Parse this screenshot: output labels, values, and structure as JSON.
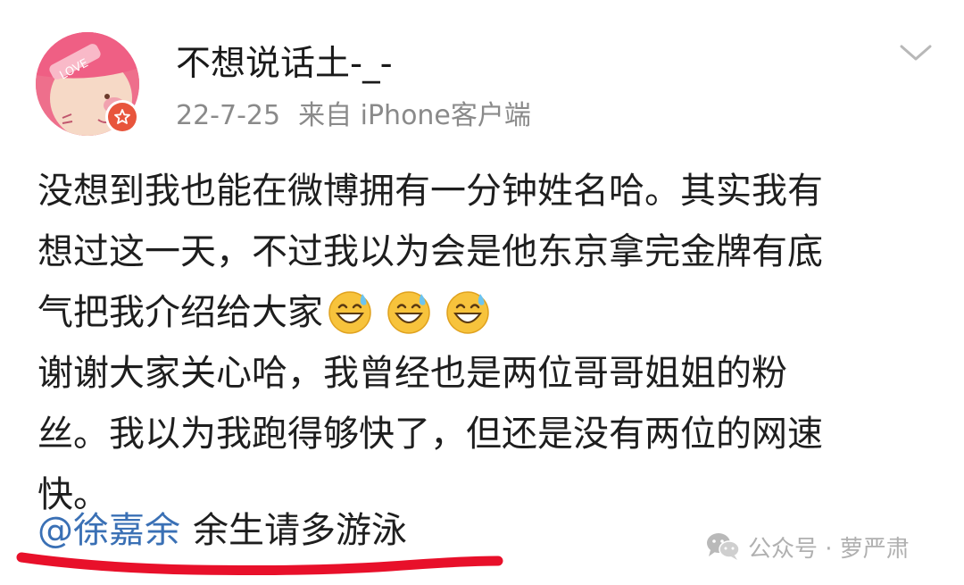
{
  "post": {
    "author": {
      "name": "不想说话土-_-",
      "avatar_text": "LOVE"
    },
    "date": "22-7-25",
    "source": "来自 iPhone客户端",
    "lines": [
      "没想到我也能在微博拥有一分钟姓名哈。其实我有",
      "想过这一天，不过我以为会是他东京拿完金牌有底",
      "气把我介绍给大家",
      "谢谢大家关心哈，我曾经也是两位哥哥姐姐的粉",
      "丝。我以为我跑得够快了，但还是没有两位的网速",
      "快。"
    ],
    "emojis": [
      "grinning-sweat-emoji",
      "grinning-sweat-emoji",
      "grinning-sweat-emoji"
    ],
    "mention": "@徐嘉余",
    "slogan": "余生请多游泳"
  },
  "watermark": {
    "text": "公众号 · 萝严肃"
  },
  "colors": {
    "mention": "#3a70b5",
    "underline": "#e8102a",
    "badge": "#e8553c",
    "avatar": "#ee6f8c",
    "meta": "#8a8a8a"
  },
  "icons": {
    "expand": "chevron-down-icon",
    "badge": "verified-star-icon",
    "watermark": "wechat-icon"
  }
}
